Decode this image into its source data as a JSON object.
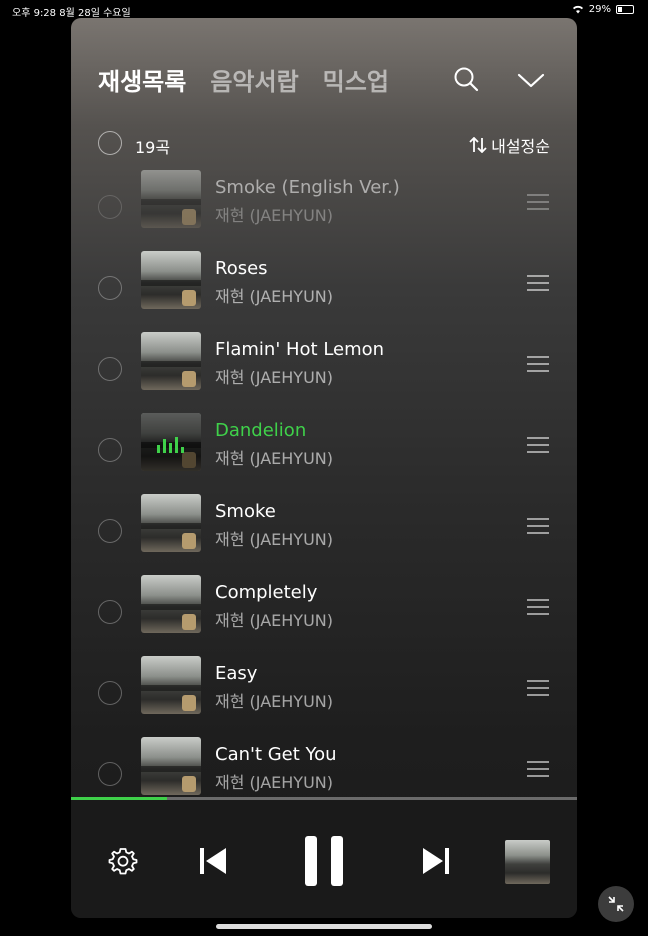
{
  "status": {
    "time": "오후 9:28",
    "date": "8월 28일 수요일",
    "battery": "29%"
  },
  "tabs": [
    {
      "label": "재생목록",
      "active": true
    },
    {
      "label": "음악서랍",
      "active": false
    },
    {
      "label": "믹스업",
      "active": false
    }
  ],
  "list": {
    "count": "19곡",
    "sort_label": "내설정순"
  },
  "tracks": [
    {
      "title": "Smoke (English Ver.)",
      "artist": "재현 (JAEHYUN)"
    },
    {
      "title": "Roses",
      "artist": "재현 (JAEHYUN)"
    },
    {
      "title": "Flamin' Hot Lemon",
      "artist": "재현 (JAEHYUN)"
    },
    {
      "title": "Dandelion",
      "artist": "재현 (JAEHYUN)",
      "playing": true
    },
    {
      "title": "Smoke",
      "artist": "재현 (JAEHYUN)"
    },
    {
      "title": "Completely",
      "artist": "재현 (JAEHYUN)"
    },
    {
      "title": "Easy",
      "artist": "재현 (JAEHYUN)"
    },
    {
      "title": "Can't Get You",
      "artist": "재현 (JAEHYUN)"
    }
  ],
  "player": {
    "progress": 0.19
  },
  "colors": {
    "accent": "#3fd14a",
    "background": "#000000"
  }
}
